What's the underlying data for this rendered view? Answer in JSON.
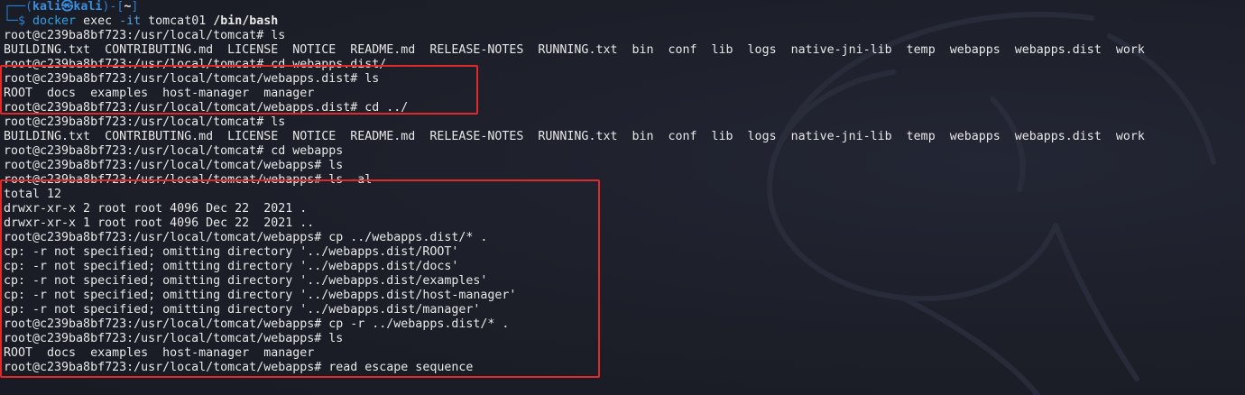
{
  "header": {
    "bracket_open": "┌──(",
    "user": "kali㉿kali",
    "bracket_mid": ")-[",
    "cwd": "~",
    "bracket_close": "]",
    "prompt_prefix": "└─$ ",
    "command": "docker",
    "args": " exec ",
    "flag": "-it",
    "container": " tomcat01 ",
    "shell": "/bin/bash"
  },
  "lines": [
    "root@c239ba8bf723:/usr/local/tomcat# ls",
    "BUILDING.txt  CONTRIBUTING.md  LICENSE  NOTICE  README.md  RELEASE-NOTES  RUNNING.txt  bin  conf  lib  logs  native-jni-lib  temp  webapps  webapps.dist  work",
    "root@c239ba8bf723:/usr/local/tomcat# cd webapps.dist/",
    "root@c239ba8bf723:/usr/local/tomcat/webapps.dist# ls",
    "ROOT  docs  examples  host-manager  manager",
    "root@c239ba8bf723:/usr/local/tomcat/webapps.dist# cd ../",
    "root@c239ba8bf723:/usr/local/tomcat# ls",
    "BUILDING.txt  CONTRIBUTING.md  LICENSE  NOTICE  README.md  RELEASE-NOTES  RUNNING.txt  bin  conf  lib  logs  native-jni-lib  temp  webapps  webapps.dist  work",
    "root@c239ba8bf723:/usr/local/tomcat# cd webapps",
    "root@c239ba8bf723:/usr/local/tomcat/webapps# ls",
    "root@c239ba8bf723:/usr/local/tomcat/webapps# ls -al",
    "total 12",
    "drwxr-xr-x 2 root root 4096 Dec 22  2021 .",
    "drwxr-xr-x 1 root root 4096 Dec 22  2021 ..",
    "root@c239ba8bf723:/usr/local/tomcat/webapps# cp ../webapps.dist/* .",
    "cp: -r not specified; omitting directory '../webapps.dist/ROOT'",
    "cp: -r not specified; omitting directory '../webapps.dist/docs'",
    "cp: -r not specified; omitting directory '../webapps.dist/examples'",
    "cp: -r not specified; omitting directory '../webapps.dist/host-manager'",
    "cp: -r not specified; omitting directory '../webapps.dist/manager'",
    "root@c239ba8bf723:/usr/local/tomcat/webapps# cp -r ../webapps.dist/* .",
    "root@c239ba8bf723:/usr/local/tomcat/webapps# ls",
    "ROOT  docs  examples  host-manager  manager",
    "root@c239ba8bf723:/usr/local/tomcat/webapps# read escape sequence"
  ],
  "colors": {
    "background": "#1c1e28",
    "text": "#e8e8e8",
    "prompt_blue": "#2f84d8",
    "highlight_box": "#e02a2a"
  }
}
